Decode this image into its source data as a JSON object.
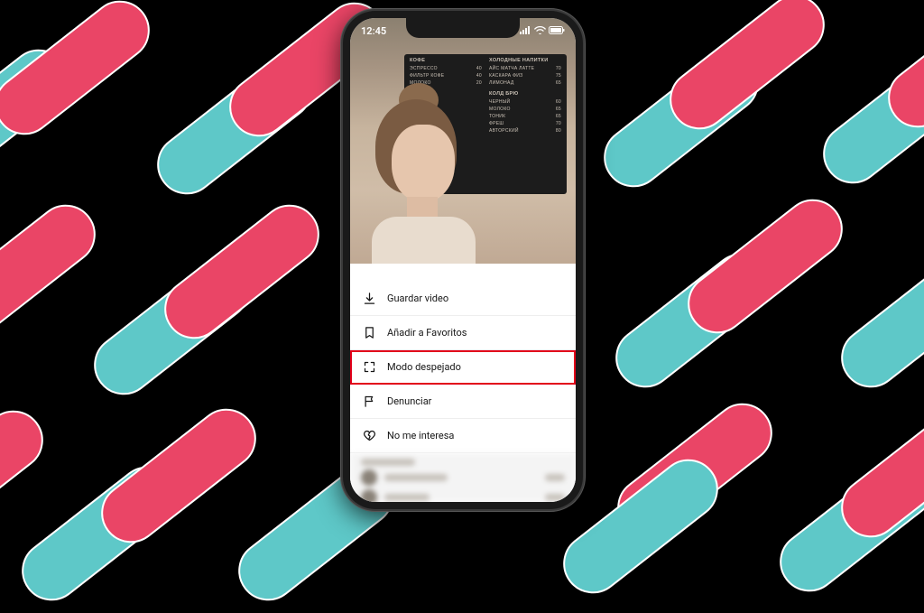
{
  "status": {
    "time": "12:45"
  },
  "board": {
    "left": {
      "header": "КОФЕ",
      "items": [
        {
          "name": "ЭСПРЕССО",
          "price": "40"
        },
        {
          "name": "ФИЛЬТР КОФЕ",
          "price": "40"
        },
        {
          "name": "МОЛОКО",
          "price": "20"
        }
      ]
    },
    "rightTop": {
      "header": "ХОЛОДНЫЕ НАПИТКИ",
      "items": [
        {
          "name": "АЙС МАТЧА ЛАТТЕ",
          "price": "70"
        },
        {
          "name": "КАСКАРА ФИЗ",
          "price": "75"
        },
        {
          "name": "ЛИМОНАД",
          "price": "65"
        }
      ]
    },
    "rightBottom": {
      "header": "КОЛД БРЮ",
      "items": [
        {
          "name": "ЧЕРНЫЙ",
          "price": "60"
        },
        {
          "name": "МОЛОКО",
          "price": "65"
        },
        {
          "name": "ТОНИК",
          "price": "65"
        },
        {
          "name": "ФРЕШ",
          "price": "70"
        },
        {
          "name": "АВТОРСКИЙ",
          "price": "80"
        }
      ]
    }
  },
  "menu": {
    "items": [
      {
        "icon": "download",
        "label": "Guardar video",
        "highlight": false
      },
      {
        "icon": "bookmark",
        "label": "Añadir a Favoritos",
        "highlight": false
      },
      {
        "icon": "expand",
        "label": "Modo despejado",
        "highlight": true
      },
      {
        "icon": "flag",
        "label": "Denunciar",
        "highlight": false
      },
      {
        "icon": "heart-broken",
        "label": "No me interesa",
        "highlight": false
      }
    ]
  },
  "colors": {
    "pink": "#ea4566",
    "teal": "#5ec8c8",
    "highlight": "#e2001a"
  }
}
